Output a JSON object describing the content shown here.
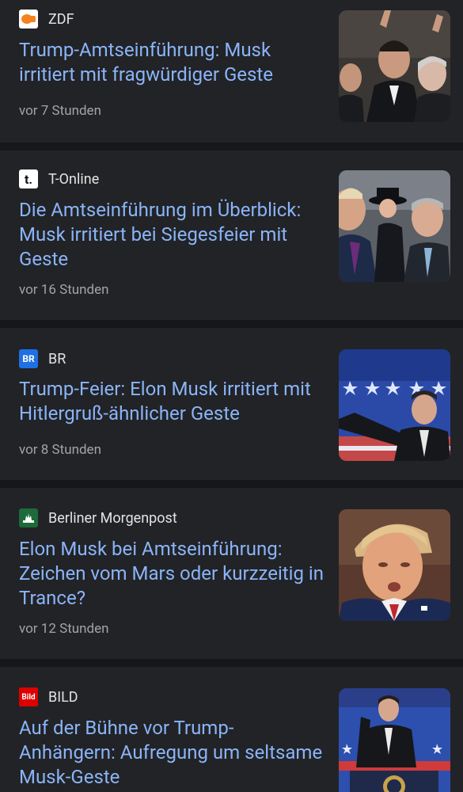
{
  "articles": [
    {
      "source": "ZDF",
      "logo_icon": "zdf-logo-icon",
      "headline": "Trump-Amtseinführung: Musk irritiert mit fragwürdiger Geste",
      "time": "vor 7 Stunden",
      "logo_color": "#f58220"
    },
    {
      "source": "T-Online",
      "logo_icon": "t-online-logo-icon",
      "logo_text": "t.",
      "headline": "Die Amtseinführung im Überblick: Musk irritiert bei Siegesfeier mit Geste",
      "time": "vor 16 Stunden",
      "logo_color": "#ffffff"
    },
    {
      "source": "BR",
      "logo_icon": "br-logo-icon",
      "logo_text": "BR",
      "headline": "Trump-Feier: Elon Musk irritiert mit Hitlergruß-ähnlicher Geste",
      "time": "vor 8 Stunden",
      "logo_color": "#1f6fe5"
    },
    {
      "source": "Berliner Morgenpost",
      "logo_icon": "berliner-morgenpost-logo-icon",
      "headline": "Elon Musk bei Amtseinführung: Zeichen vom Mars oder kurzzeitig in Trance?",
      "time": "vor 12 Stunden",
      "logo_color": "#1d6b3a"
    },
    {
      "source": "BILD",
      "logo_icon": "bild-logo-icon",
      "logo_text": "Bild",
      "headline": "Auf der Bühne vor Trump-Anhängern: Aufregung um seltsame Musk-Geste",
      "logo_color": "#dd0000"
    }
  ],
  "colors": {
    "background": "#1a1b1e",
    "card": "#222326",
    "headline": "#8ab4f8",
    "meta": "#a3a3a3"
  }
}
